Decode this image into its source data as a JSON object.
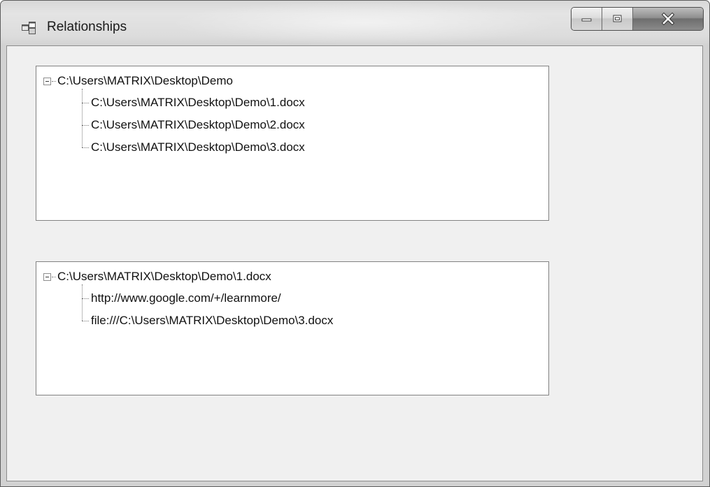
{
  "window": {
    "title": "Relationships"
  },
  "icons": {
    "app": "form-window-icon",
    "minimize": "minimize-icon",
    "maximize": "maximize-icon",
    "close": "close-icon",
    "expander": "collapse-minus-icon"
  },
  "tree_top": {
    "root": "C:\\Users\\MATRIX\\Desktop\\Demo",
    "children": [
      "C:\\Users\\MATRIX\\Desktop\\Demo\\1.docx",
      "C:\\Users\\MATRIX\\Desktop\\Demo\\2.docx",
      "C:\\Users\\MATRIX\\Desktop\\Demo\\3.docx"
    ]
  },
  "tree_bottom": {
    "root": "C:\\Users\\MATRIX\\Desktop\\Demo\\1.docx",
    "children": [
      "http://www.google.com/+/learnmore/",
      "file:///C:\\Users\\MATRIX\\Desktop\\Demo\\3.docx"
    ]
  }
}
